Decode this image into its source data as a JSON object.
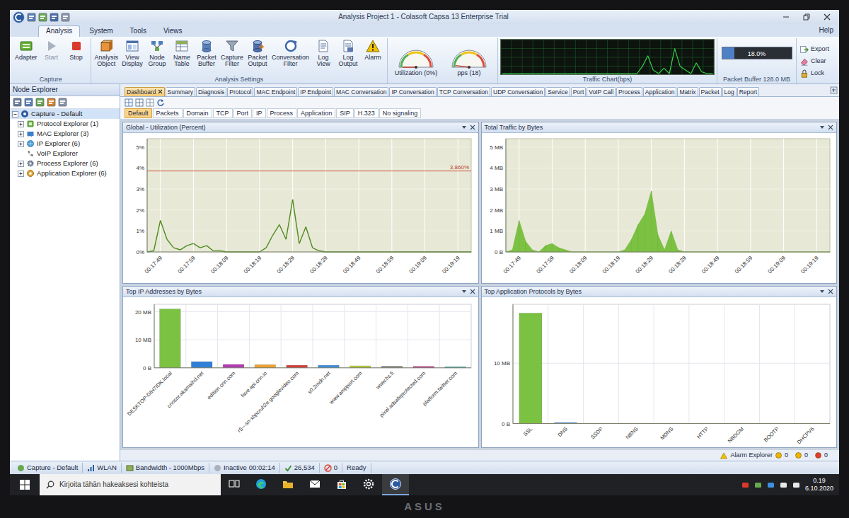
{
  "window": {
    "title": "Analysis Project 1 - Colasoft Capsa 13 Enterprise Trial"
  },
  "ribbon": {
    "tabs": [
      {
        "label": "Analysis",
        "selected": true
      },
      {
        "label": "System",
        "selected": false
      },
      {
        "label": "Tools",
        "selected": false
      },
      {
        "label": "Views",
        "selected": false
      }
    ],
    "help": "Help",
    "groups": [
      {
        "label": "Capture",
        "buttons": [
          {
            "label": "Adapter",
            "kind": "adapter",
            "disabled": false
          },
          {
            "label": "Start",
            "kind": "start",
            "disabled": true
          },
          {
            "label": "Stop",
            "kind": "stop",
            "disabled": false
          }
        ]
      },
      {
        "label": "Analysis Settings",
        "buttons": [
          {
            "label": "Analysis Object",
            "kind": "object",
            "disabled": false
          },
          {
            "label": "View Display",
            "kind": "display",
            "disabled": false
          },
          {
            "label": "Node Group",
            "kind": "group",
            "disabled": false
          },
          {
            "label": "Name Table",
            "kind": "table",
            "disabled": false
          },
          {
            "label": "Packet Buffer",
            "kind": "buffer",
            "disabled": false
          },
          {
            "label": "Capture Filter",
            "kind": "filter",
            "disabled": false
          },
          {
            "label": "Packet Output",
            "kind": "output",
            "disabled": false
          },
          {
            "label": "Conversation Filter",
            "kind": "conversation",
            "disabled": false
          },
          {
            "label": "Log View",
            "kind": "logview",
            "disabled": false
          },
          {
            "label": "Log Output",
            "kind": "logoutput",
            "disabled": false
          },
          {
            "label": "Alarm",
            "kind": "alarm",
            "disabled": false
          }
        ]
      }
    ],
    "gauges": [
      {
        "label": "Utilization (0%)",
        "level": 0.0
      },
      {
        "label": "pps (18)",
        "level": 0.04
      }
    ],
    "traffic_chart": {
      "label": "Traffic Chart(bps)",
      "values": [
        0,
        0,
        0,
        0,
        0,
        0,
        0,
        0,
        0,
        0,
        0,
        0,
        0,
        0,
        0,
        0,
        0,
        0,
        0,
        0,
        0,
        0,
        0,
        0,
        0,
        0,
        0.2,
        0.5,
        0.1,
        0,
        0.15,
        0,
        0.7,
        0.2,
        0.1,
        0,
        0.3,
        0.05,
        0,
        0
      ]
    },
    "packet_buffer": {
      "reading": "18.0%",
      "level": 0.18,
      "label": "Packet Buffer 128.0 MB"
    },
    "actions": [
      {
        "label": "Export",
        "kind": "export"
      },
      {
        "label": "Clear",
        "kind": "clear"
      },
      {
        "label": "Lock",
        "kind": "lock"
      }
    ]
  },
  "node_explorer": {
    "title": "Node Explorer",
    "tree": {
      "label": "Capture - Default",
      "expanded": true,
      "selected": true,
      "children": [
        {
          "label": "Protocol Explorer (1)",
          "kind": "protocol",
          "expandable": true,
          "expanded": false
        },
        {
          "label": "MAC Explorer (3)",
          "kind": "mac",
          "expandable": true,
          "expanded": false
        },
        {
          "label": "IP Explorer (6)",
          "kind": "ip",
          "expandable": true,
          "expanded": false
        },
        {
          "label": "VoIP Explorer",
          "kind": "voip",
          "expandable": false,
          "expanded": false
        },
        {
          "label": "Process Explorer (6)",
          "kind": "process",
          "expandable": true,
          "expanded": false
        },
        {
          "label": "Application Explorer (6)",
          "kind": "application",
          "expandable": true,
          "expanded": false
        }
      ]
    }
  },
  "tabs": [
    {
      "label": "Dashboard",
      "selected": true
    },
    {
      "label": "Summary",
      "selected": false
    },
    {
      "label": "Diagnosis",
      "selected": false
    },
    {
      "label": "Protocol",
      "selected": false
    },
    {
      "label": "MAC Endpoint",
      "selected": false
    },
    {
      "label": "IP Endpoint",
      "selected": false
    },
    {
      "label": "MAC Conversation",
      "selected": false
    },
    {
      "label": "IP Conversation",
      "selected": false
    },
    {
      "label": "TCP Conversation",
      "selected": false
    },
    {
      "label": "UDP Conversation",
      "selected": false
    },
    {
      "label": "Service",
      "selected": false
    },
    {
      "label": "Port",
      "selected": false
    },
    {
      "label": "VoIP Call",
      "selected": false
    },
    {
      "label": "Process",
      "selected": false
    },
    {
      "label": "Application",
      "selected": false
    },
    {
      "label": "Matrix",
      "selected": false
    },
    {
      "label": "Packet",
      "selected": false
    },
    {
      "label": "Log",
      "selected": false
    },
    {
      "label": "Report",
      "selected": false
    }
  ],
  "subtabs": [
    {
      "label": "Default",
      "selected": true
    },
    {
      "label": "Packets",
      "selected": false
    },
    {
      "label": "Domain",
      "selected": false
    },
    {
      "label": "TCP",
      "selected": false
    },
    {
      "label": "Port",
      "selected": false
    },
    {
      "label": "IP",
      "selected": false
    },
    {
      "label": "Process",
      "selected": false
    },
    {
      "label": "Application",
      "selected": false
    },
    {
      "label": "SIP",
      "selected": false
    },
    {
      "label": "H.323",
      "selected": false
    },
    {
      "label": "No signaling",
      "selected": false
    }
  ],
  "panels": {
    "utilization": {
      "title": "Global - Utilization (Percent)",
      "y_ticks": [
        {
          "label": "0%",
          "value": 0
        },
        {
          "label": "1%",
          "value": 1
        },
        {
          "label": "2%",
          "value": 2
        },
        {
          "label": "3%",
          "value": 3
        },
        {
          "label": "4%",
          "value": 4
        },
        {
          "label": "5%",
          "value": 5
        }
      ],
      "x_ticks": [
        {
          "label": "00:17:49",
          "at": 2
        },
        {
          "label": "00:17:59",
          "at": 7
        },
        {
          "label": "00:18:09",
          "at": 12
        },
        {
          "label": "00:18:19",
          "at": 17
        },
        {
          "label": "00:18:29",
          "at": 22
        },
        {
          "label": "00:18:39",
          "at": 27
        },
        {
          "label": "00:18:49",
          "at": 32
        },
        {
          "label": "00:18:59",
          "at": 37
        },
        {
          "label": "00:19:09",
          "at": 42
        },
        {
          "label": "00:19:19",
          "at": 47
        }
      ],
      "values": [
        0,
        0.05,
        1.5,
        0.6,
        0.2,
        0.1,
        0.3,
        0.4,
        0.2,
        0.3,
        0.05,
        0.05,
        0,
        0,
        0,
        0,
        0,
        0,
        0.2,
        0.8,
        1.3,
        0.6,
        2.5,
        0.4,
        1.2,
        0.2,
        0.05,
        0,
        0,
        0,
        0,
        0,
        0,
        0,
        0,
        0,
        0,
        0,
        0,
        0,
        0,
        0,
        0,
        0,
        0,
        0,
        0,
        0,
        0,
        0
      ],
      "threshold": {
        "label": "3.860%",
        "value": 3.86
      }
    },
    "traffic": {
      "title": "Total Traffic by Bytes",
      "y_ticks": [
        {
          "label": "0 B",
          "value": 0
        },
        {
          "label": "1 MB",
          "value": 1
        },
        {
          "label": "2 MB",
          "value": 2
        },
        {
          "label": "3 MB",
          "value": 3
        },
        {
          "label": "4 MB",
          "value": 4
        },
        {
          "label": "5 MB",
          "value": 5
        }
      ],
      "x_ticks": [
        {
          "label": "00:17:49",
          "at": 2
        },
        {
          "label": "00:17:59",
          "at": 7
        },
        {
          "label": "00:18:09",
          "at": 12
        },
        {
          "label": "00:18:19",
          "at": 17
        },
        {
          "label": "00:18:29",
          "at": 22
        },
        {
          "label": "00:18:39",
          "at": 27
        },
        {
          "label": "00:18:49",
          "at": 32
        },
        {
          "label": "00:18:59",
          "at": 37
        },
        {
          "label": "00:19:09",
          "at": 42
        },
        {
          "label": "00:19:19",
          "at": 47
        }
      ],
      "values": [
        0,
        0.1,
        1.5,
        0.5,
        0.1,
        0,
        0.3,
        0.4,
        0.2,
        0.1,
        0,
        0,
        0,
        0,
        0,
        0,
        0,
        0,
        0.1,
        0.6,
        1.3,
        1.8,
        2.9,
        0.8,
        0.1,
        1.0,
        0.1,
        0,
        0,
        0,
        0,
        0,
        0,
        0,
        0,
        0,
        0,
        0,
        0,
        0,
        0,
        0,
        0,
        0,
        0,
        0,
        0,
        0,
        0,
        0
      ]
    },
    "top_ips": {
      "title": "Top IP Addresses by Bytes",
      "y_ticks": [
        {
          "label": "0 B",
          "value": 0
        },
        {
          "label": "10 MB",
          "value": 10
        },
        {
          "label": "20 MB",
          "value": 20
        }
      ],
      "bars": [
        {
          "label": "DESKTOP-DIH7IDK.local",
          "value": 21.0,
          "color": "#7cc242"
        },
        {
          "label": "cnosor.akamaihd.net",
          "value": 2.2,
          "color": "#2f7fd8"
        },
        {
          "label": "edition.cnn.com",
          "value": 1.2,
          "color": "#b23ab5"
        },
        {
          "label": "fave.api.cnn.io",
          "value": 1.1,
          "color": "#f0a030"
        },
        {
          "label": "r5---sn-xbpcruh2e.googlevideo.com",
          "value": 0.9,
          "color": "#d83a3a"
        },
        {
          "label": "s0.2mdn.net",
          "value": 0.9,
          "color": "#3d8fe0"
        },
        {
          "label": "www.ampport.com",
          "value": 0.7,
          "color": "#b7cf3a"
        },
        {
          "label": "www.hs.fi",
          "value": 0.6,
          "color": "#8d8d8d"
        },
        {
          "label": "pixel.adsafeprotected.com",
          "value": 0.5,
          "color": "#c0308a"
        },
        {
          "label": "platform.twitter.com",
          "value": 0.4,
          "color": "#3fb0b0"
        }
      ]
    },
    "top_apps": {
      "title": "Top Application Protocols by Bytes",
      "y_ticks": [
        {
          "label": "0 B",
          "value": 0
        },
        {
          "label": "10 MB",
          "value": 10
        }
      ],
      "bars": [
        {
          "label": "SSL",
          "value": 18.3,
          "color": "#7cc242"
        },
        {
          "label": "DNS",
          "value": 0.15,
          "color": "#2f7fd8"
        },
        {
          "label": "SSDP",
          "value": 0.05,
          "color": "#b23ab5"
        },
        {
          "label": "NBNS",
          "value": 0.03,
          "color": "#f0a030"
        },
        {
          "label": "MDNS",
          "value": 0.02,
          "color": "#d83a3a"
        },
        {
          "label": "HTTP",
          "value": 0.02,
          "color": "#3d8fe0"
        },
        {
          "label": "NBDGM",
          "value": 0.01,
          "color": "#b7cf3a"
        },
        {
          "label": "BOOTP",
          "value": 0.01,
          "color": "#8d8d8d"
        },
        {
          "label": "DHCPV6",
          "value": 0.005,
          "color": "#c0308a"
        }
      ]
    }
  },
  "alarm_explorer": {
    "label": "Alarm Explorer",
    "counts": [
      {
        "value": "0",
        "color": "#f0b400"
      },
      {
        "value": "0",
        "color": "#f0b400"
      },
      {
        "value": "0",
        "color": "#e03c31"
      }
    ]
  },
  "status_bar": {
    "capture": "Capture - Default",
    "adapter": "WLAN",
    "bandwidth": "Bandwidth - 1000Mbps",
    "state": "Inactive",
    "elapsed": "00:02:14",
    "packets": "26,534",
    "alarms": "0",
    "message": "Ready"
  },
  "taskbar": {
    "search": "Kirjoita tähän hakeaksesi kohteista",
    "apps": [
      {
        "kind": "taskview",
        "active": false
      },
      {
        "kind": "edge",
        "active": false
      },
      {
        "kind": "explorer",
        "active": false
      },
      {
        "kind": "mail",
        "active": false
      },
      {
        "kind": "store",
        "active": false
      },
      {
        "kind": "settings",
        "active": false
      },
      {
        "kind": "capsa",
        "active": true
      }
    ],
    "time": "0.19",
    "date": "6.10.2020"
  },
  "bezel": {
    "logo": "ASUS"
  }
}
